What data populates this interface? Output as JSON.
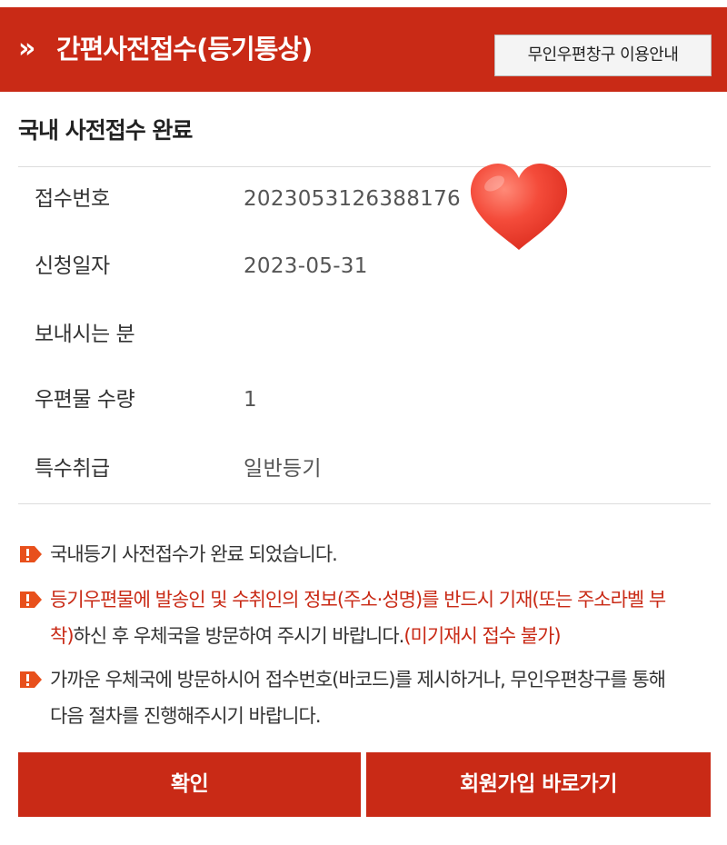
{
  "header": {
    "arrow": "»",
    "title": "간편사전접수(등기통상)",
    "guide_button": "무인우편창구 이용안내"
  },
  "section_title": "국내 사전접수 완료",
  "info": [
    {
      "label": "접수번호",
      "value": "20230531263881​76"
    },
    {
      "label": "신청일자",
      "value": "2023-05-31"
    },
    {
      "label": "보내시는 분",
      "value": ""
    },
    {
      "label": "우편물 수량",
      "value": "1"
    },
    {
      "label": "특수취급",
      "value": "일반등기"
    }
  ],
  "notices": {
    "n1": "국내등기 사전접수가 완료 되었습니다.",
    "n2_line1": "등기우편물에 발송인 및 수취인의 정보(주소·성명)를 반드시 기재(또는 주소라벨 부",
    "n2_line2_red": "착)",
    "n2_line2_black": "하신 후 우체국을 방문하여 주시기 바랍니다.",
    "n2_line2_red2": "(미기재시 접수 불가)",
    "n3_line1": "가까운 우체국에 방문하시어 접수번호(바코드)를 제시하거나, 무인우편창구를 통해",
    "n3_line2": "다음 절차를 진행해주시기 바랍니다."
  },
  "buttons": {
    "confirm": "확인",
    "signup": "회원가입 바로가기"
  },
  "colors": {
    "brand_red": "#c92a16",
    "notice_icon": "#e8501c",
    "heart": "#f44b3a"
  }
}
